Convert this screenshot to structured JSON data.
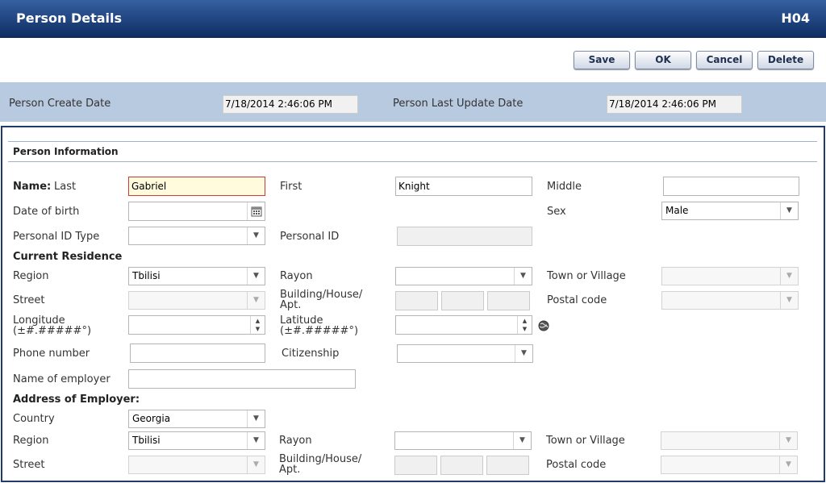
{
  "header": {
    "title": "Person Details",
    "code": "H04"
  },
  "toolbar": {
    "save": "Save",
    "ok": "OK",
    "cancel": "Cancel",
    "delete": "Delete"
  },
  "dates": {
    "create_label": "Person Create Date",
    "create_value": "7/18/2014 2:46:06 PM",
    "update_label": "Person Last Update Date",
    "update_value": "7/18/2014 2:46:06 PM"
  },
  "person": {
    "section_title": "Person Information",
    "name_label": "Name:",
    "last_label": "Last",
    "last_value": "Gabriel",
    "first_label": "First",
    "first_value": "Knight",
    "middle_label": "Middle",
    "middle_value": "",
    "dob_label": "Date of birth",
    "dob_value": "",
    "sex_label": "Sex",
    "sex_value": "Male",
    "pid_type_label": "Personal ID Type",
    "pid_type_value": "",
    "pid_label": "Personal ID",
    "pid_value": ""
  },
  "residence": {
    "title": "Current Residence",
    "region_label": "Region",
    "region_value": "Tbilisi",
    "rayon_label": "Rayon",
    "rayon_value": "",
    "town_label": "Town or Village",
    "town_value": "",
    "street_label": "Street",
    "street_value": "",
    "building_label": "Building/House/\nApt.",
    "postal_label": "Postal code",
    "postal_value": "",
    "longitude_label": "Longitude\n(±#.#####°)",
    "longitude_value": "",
    "latitude_label": "Latitude\n(±#.#####°)",
    "latitude_value": "",
    "phone_label": "Phone number",
    "phone_value": "",
    "citizenship_label": "Citizenship",
    "citizenship_value": ""
  },
  "employer": {
    "name_label": "Name of employer",
    "name_value": "",
    "address_title": "Address of Employer:",
    "country_label": "Country",
    "country_value": "Georgia",
    "region_label": "Region",
    "region_value": "Tbilisi",
    "rayon_label": "Rayon",
    "rayon_value": "",
    "town_label": "Town or Village",
    "town_value": "",
    "street_label": "Street",
    "street_value": "",
    "building_label": "Building/House/\nApt.",
    "postal_label": "Postal code",
    "postal_value": ""
  },
  "icons": {
    "dropdown": "chevron-down-icon",
    "calendar": "calendar-icon",
    "globe": "globe-icon",
    "spinner": "spinner-icon"
  }
}
